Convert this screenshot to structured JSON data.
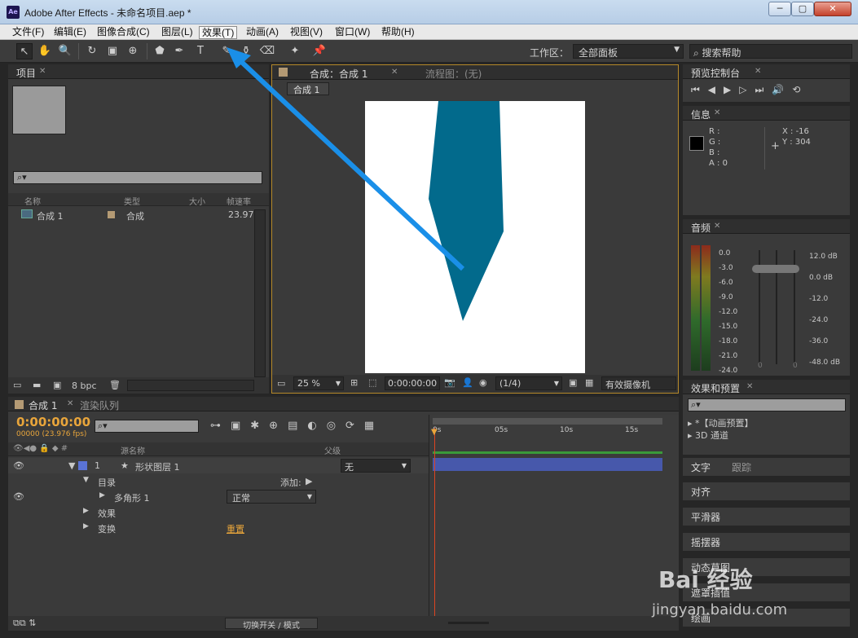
{
  "window": {
    "title": "Adobe After Effects - 未命名项目.aep *",
    "logo": "Ae",
    "min": "─",
    "max": "▢",
    "close": "✕"
  },
  "menu": [
    "文件(F)",
    "编辑(E)",
    "图像合成(C)",
    "图层(L)",
    "效果(T)",
    "动画(A)",
    "视图(V)",
    "窗口(W)",
    "帮助(H)"
  ],
  "toolbar": {
    "workspace_label": "工作区：",
    "workspace_value": "全部面板",
    "search_help": "搜索帮助"
  },
  "project": {
    "tab": "项目",
    "cols": [
      "名称",
      "类型",
      "大小",
      "帧速率"
    ],
    "item": {
      "name": "合成 1",
      "type": "合成",
      "fps": "23.976"
    },
    "bpc": "8 bpc"
  },
  "comp": {
    "tab": "合成：合成 1",
    "flow_tab": "流程图：(无)",
    "sub_tab": "合成 1",
    "zoom": "25 %",
    "timecode": "0:00:00:00",
    "resolution": "(1/4)",
    "camera": "有效摄像机",
    "shape_color": "#026a8c"
  },
  "preview": {
    "tab": "预览控制台"
  },
  "info": {
    "tab": "信息",
    "r": "R :",
    "g": "G :",
    "b": "B :",
    "a": "A : 0",
    "x": "X : -16",
    "y": "Y : 304"
  },
  "audio": {
    "tab": "音频",
    "left_scale": [
      "0.0",
      "-3.0",
      "-6.0",
      "-9.0",
      "-12.0",
      "-15.0",
      "-18.0",
      "-21.0",
      "-24.0"
    ],
    "right_scale": [
      "12.0 dB",
      "0.0 dB",
      "-12.0",
      "-24.0",
      "-36.0",
      "-48.0 dB"
    ],
    "bottom": [
      "0",
      "0"
    ]
  },
  "effects": {
    "tab": "效果和预置",
    "items": [
      "*【动画预置】",
      "3D 通道"
    ]
  },
  "right_panels": [
    "文字",
    "跟踪",
    "对齐",
    "平滑器",
    "摇摆器",
    "动态草图",
    "遮罩插值",
    "绘画"
  ],
  "timeline": {
    "tab": "合成 1",
    "render_tab": "渲染队列",
    "timecode": "0:00:00:00",
    "fps": "00000 (23.976 fps)",
    "col_source": "源名称",
    "col_parent": "父级",
    "layer_num": "1",
    "layer_name": "形状图层 1",
    "parent": "无",
    "rows": {
      "contents": "目录",
      "add": "添加:",
      "polygon": "多角形 1",
      "blend": "正常",
      "effects": "效果",
      "transform": "变换",
      "reset": "重置"
    },
    "ruler": [
      "0s",
      "05s",
      "10s",
      "15s"
    ],
    "toggle": "切换开关 / 模式"
  },
  "watermark": {
    "brand": "Bai 经验",
    "url": "jingyan.baidu.com"
  }
}
